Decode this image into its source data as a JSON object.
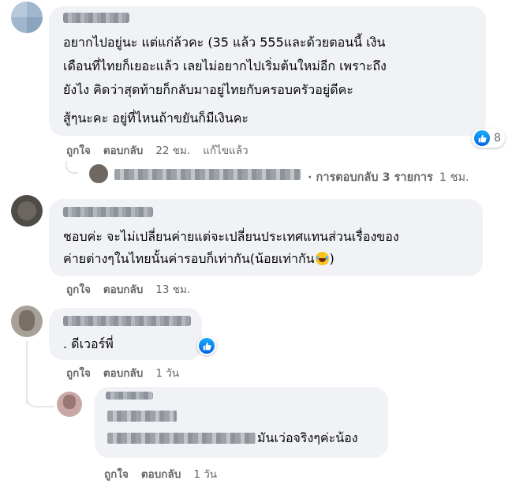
{
  "comments": [
    {
      "text_lines": [
        "อยากไปอยู่นะ แต่แก่ล้วคะ (35 แล้ว 555และด้วยตอนนี้ เงิน",
        "เดือนที่ไทยก็เยอะแล้ว เลยไม่อยากไปเริ่มต้นใหม่อีก เพราะถึง",
        "ยังไง คิดว่าสุดท้ายก็กลับมาอยู่ไทยกับครอบครัวอยู่ดีคะ",
        "สู้ๆนะคะ อยู่ที่ไหนถ้าขยันก็มีเงินคะ"
      ],
      "like_label": "ถูกใจ",
      "reply_label": "ตอบกลับ",
      "time": "22 ชม.",
      "edited_label": "แก้ไขแล้ว",
      "reaction_count": "8",
      "replies_summary": "· การตอบกลับ 3 รายการ",
      "replies_time": "1 ชม."
    },
    {
      "text_lines": [
        "ชอบค่ะ จะไม่เปลี่ยนค่ายแต่จะเปลี่ยนประเทศแทนส่วนเรื่องของ",
        "ค่ายต่างๆในไทยนั้นค่ารอบก็เท่ากัน(น้อยเท่ากัน",
        ")"
      ],
      "like_label": "ถูกใจ",
      "reply_label": "ตอบกลับ",
      "time": "13 ชม."
    },
    {
      "text_lines": [
        ". ดีเวอร์พี่"
      ],
      "like_label": "ถูกใจ",
      "reply_label": "ตอบกลับ",
      "time": "1 วัน"
    },
    {
      "text_lines": [
        "มันเว่อจริงๆค่ะน้อง"
      ],
      "like_label": "ถูกใจ",
      "reply_label": "ตอบกลับ",
      "time": "1 วัน"
    }
  ],
  "icons": {
    "like": "thumbs-up-icon",
    "laugh": "laughing-emoji-icon"
  },
  "colors": {
    "bubble": "#f0f2f5",
    "meta_text": "#65676b",
    "like_blue": "#0866ff"
  }
}
